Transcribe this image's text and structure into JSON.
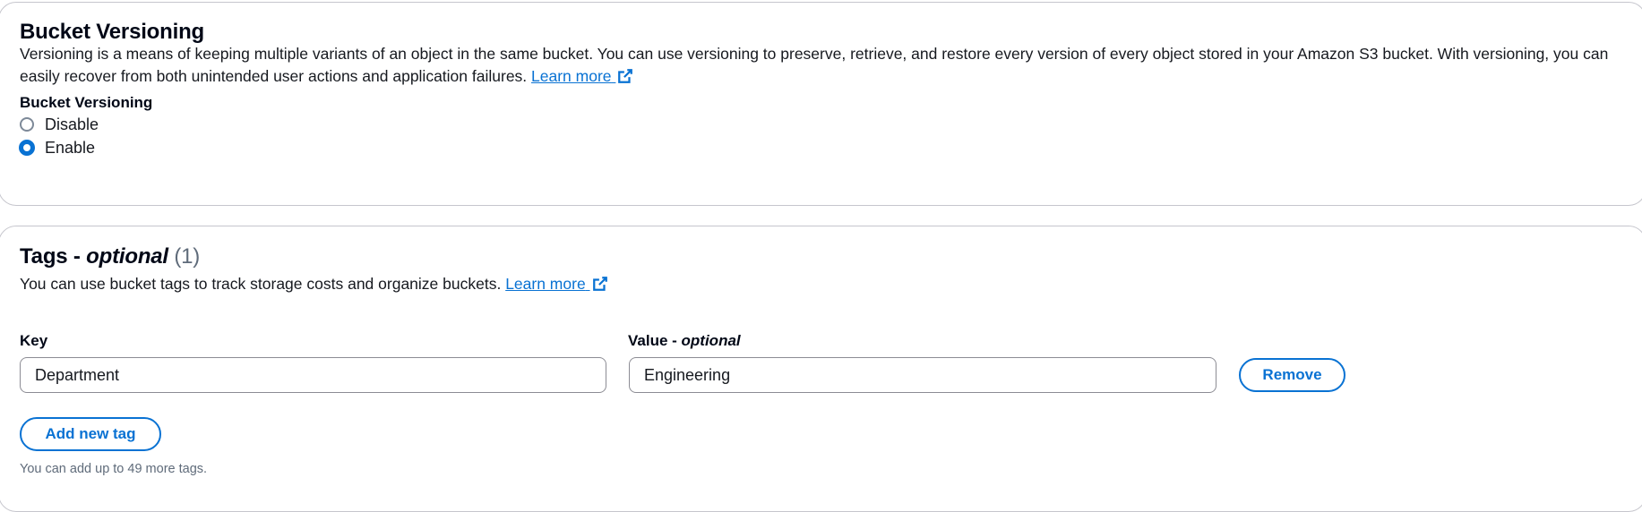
{
  "versioning": {
    "title": "Bucket Versioning",
    "description": "Versioning is a means of keeping multiple variants of an object in the same bucket. You can use versioning to preserve, retrieve, and restore every version of every object stored in your Amazon S3 bucket. With versioning, you can easily recover from both unintended user actions and application failures. ",
    "learn_more": "Learn more",
    "field_label": "Bucket Versioning",
    "options": [
      {
        "label": "Disable",
        "checked": false
      },
      {
        "label": "Enable",
        "checked": true
      }
    ]
  },
  "tags": {
    "title_main": "Tags - ",
    "title_italic": "optional",
    "count": "(1)",
    "description": "You can use bucket tags to track storage costs and organize buckets. ",
    "learn_more": "Learn more",
    "key_label": "Key",
    "value_label_main": "Value - ",
    "value_label_italic": "optional",
    "rows": [
      {
        "key": "Department",
        "value": "Engineering",
        "remove_label": "Remove"
      }
    ],
    "add_label": "Add new tag",
    "hint": "You can add up to 49 more tags."
  },
  "colors": {
    "accent": "#0972d3",
    "text": "#16191f",
    "border": "#c6c6cd",
    "muted": "#5f6b7a"
  },
  "icons": {
    "external_link": "external-link-icon"
  }
}
